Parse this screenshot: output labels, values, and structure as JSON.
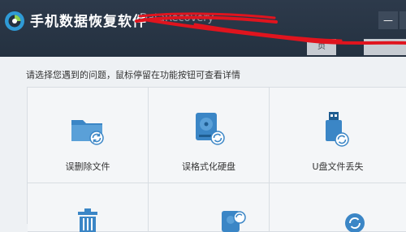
{
  "app": {
    "title": "手机数据恢复软件",
    "subtitle": "DataRecovery"
  },
  "window_controls": {
    "minimize_symbol": "—"
  },
  "tabs": [
    {
      "label": "页"
    },
    {
      "label": ""
    }
  ],
  "instruction": "请选择您遇到的问题，鼠标停留在功能按钮可查看详情",
  "options": [
    {
      "label": "误删除文件",
      "icon": "folder-restore-icon"
    },
    {
      "label": "误格式化硬盘",
      "icon": "harddisk-restore-icon"
    },
    {
      "label": "U盘文件丢失",
      "icon": "usb-drive-restore-icon"
    },
    {
      "label": "",
      "icon": "recycle-bin-icon"
    },
    {
      "label": "",
      "icon": "device-restore-icon"
    },
    {
      "label": "",
      "icon": "refresh-icon"
    }
  ],
  "colors": {
    "titlebar": "#263343",
    "icon_blue": "#3b86c6",
    "scribble_red": "#e0141e"
  }
}
